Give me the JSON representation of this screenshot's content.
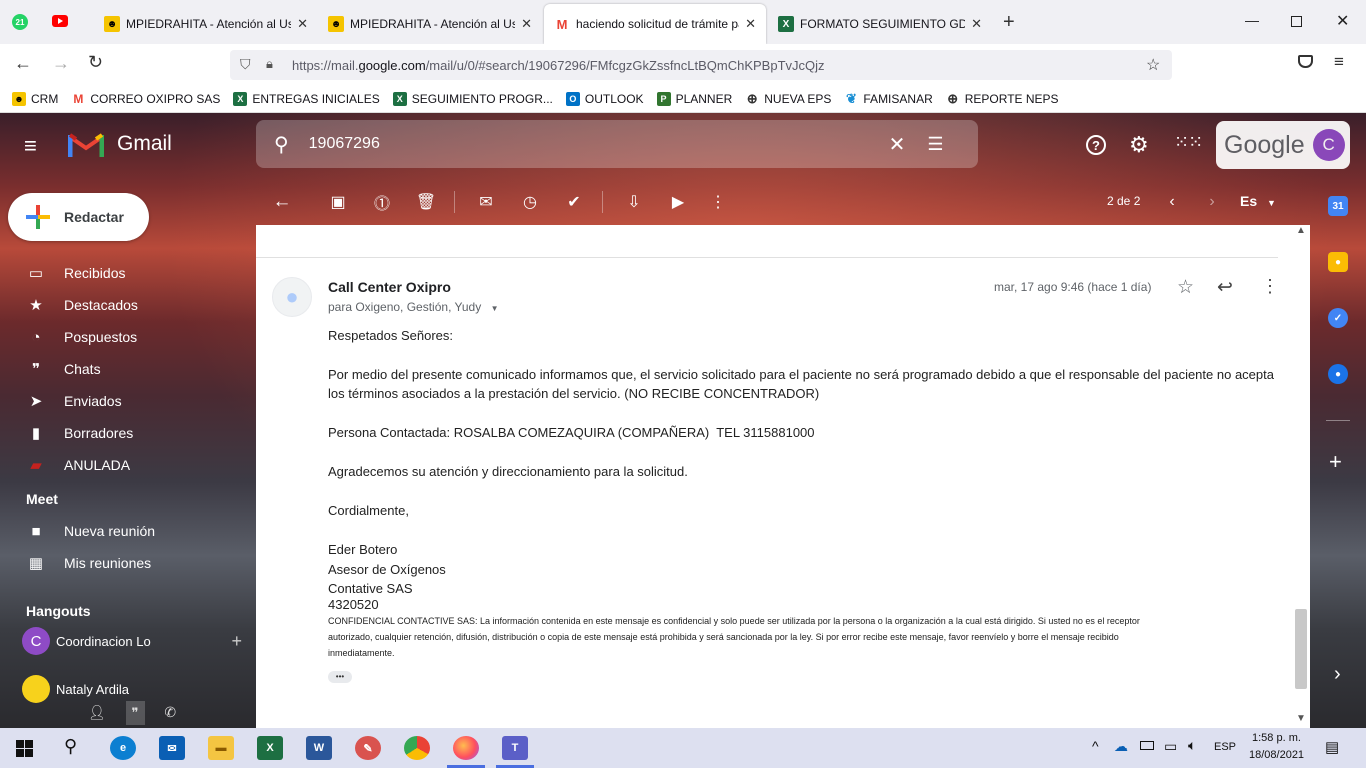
{
  "browser": {
    "tabs": [
      {
        "title": "MPIEDRAHITA - Atención al Usuario",
        "icon": "crm-icon"
      },
      {
        "title": "MPIEDRAHITA - Atención al Usuario",
        "icon": "crm-icon"
      },
      {
        "title": "haciendo solicitud de trámite para",
        "icon": "gmail-icon",
        "active": true
      },
      {
        "title": "FORMATO SEGUIMIENTO GD.xlsx",
        "icon": "excel-icon"
      }
    ],
    "pinned_badge": "21",
    "url_prefix": "https://mail.",
    "url_domain": "google.com",
    "url_rest": "/mail/u/0/#search/19067296/FMfcgzGkZssfncLtBQmChKPBpTvJcQjz",
    "bookmarks": [
      "CRM",
      "CORREO OXIPRO SAS",
      "ENTREGAS INICIALES",
      "SEGUIMIENTO PROGR...",
      "OUTLOOK",
      "PLANNER",
      "NUEVA EPS",
      "FAMISANAR",
      "REPORTE NEPS"
    ]
  },
  "gmail": {
    "logo_text": "Gmail",
    "search_value": "19067296",
    "google_label": "Google",
    "avatar_letter": "C",
    "compose_label": "Redactar",
    "nav": [
      {
        "label": "Recibidos",
        "icon": "inbox-icon"
      },
      {
        "label": "Destacados",
        "icon": "star-icon"
      },
      {
        "label": "Pospuestos",
        "icon": "clock-icon"
      },
      {
        "label": "Chats",
        "icon": "chat-icon"
      },
      {
        "label": "Enviados",
        "icon": "send-icon"
      },
      {
        "label": "Borradores",
        "icon": "draft-icon"
      },
      {
        "label": "ANULADA",
        "icon": "label-icon"
      }
    ],
    "meet_title": "Meet",
    "meet": [
      "Nueva reunión",
      "Mis reuniones"
    ],
    "hangouts_title": "Hangouts",
    "hangouts": [
      {
        "name": "Coordinacion Lo",
        "avatar": "C"
      },
      {
        "name": "Nataly Ardila",
        "avatar": ""
      }
    ],
    "pager": "2 de 2",
    "lang": "Es",
    "message": {
      "sender": "Call Center Oxipro",
      "recipients": "para Oxigeno, Gestión, Yudy",
      "date": "mar, 17 ago 9:46 (hace 1 día)",
      "greeting": "Respetados Señores:",
      "p1_line1": "Por medio del presente comunicado informamos que, el servicio solicitado para el paciente no será programado debido a que el responsable del paciente no acepta",
      "p1_line2": "los términos asociados a la prestación del servicio. (NO RECIBE CONCENTRADOR)",
      "p2": "Persona Contactada: ROSALBA COMEZAQUIRA (COMPAÑERA)  TEL 3115881000",
      "p3": "Agradecemos su atención y direccionamiento para la solicitud.",
      "closing": "Cordialmente,",
      "sig_name": "Eder Botero",
      "sig_role": "Asesor de Oxígenos",
      "sig_company": "Contative SAS",
      "sig_phone": "4320520",
      "disclaimer_1": "CONFIDENCIAL CONTACTIVE SAS: La información contenida en este mensaje es confidencial y solo puede ser utilizada por la persona o la organización a la cual está dirigido. Si usted no es el receptor",
      "disclaimer_2": "autorizado, cualquier retención, difusión, distribución o copia de este mensaje está prohibida y será sancionada por la ley. Si por error recibe este mensaje, favor reenvíelo y borre el mensaje recibido",
      "disclaimer_3": "inmediatamente.",
      "more_label": "•••"
    }
  },
  "taskbar": {
    "lang": "ESP",
    "time": "1:58 p. m.",
    "date": "18/08/2021"
  },
  "colors": {
    "gmail_red": "#ea4335",
    "avatar_purple": "#8e4bc6",
    "excel_green": "#1d6f42",
    "word_blue": "#2b579a"
  }
}
